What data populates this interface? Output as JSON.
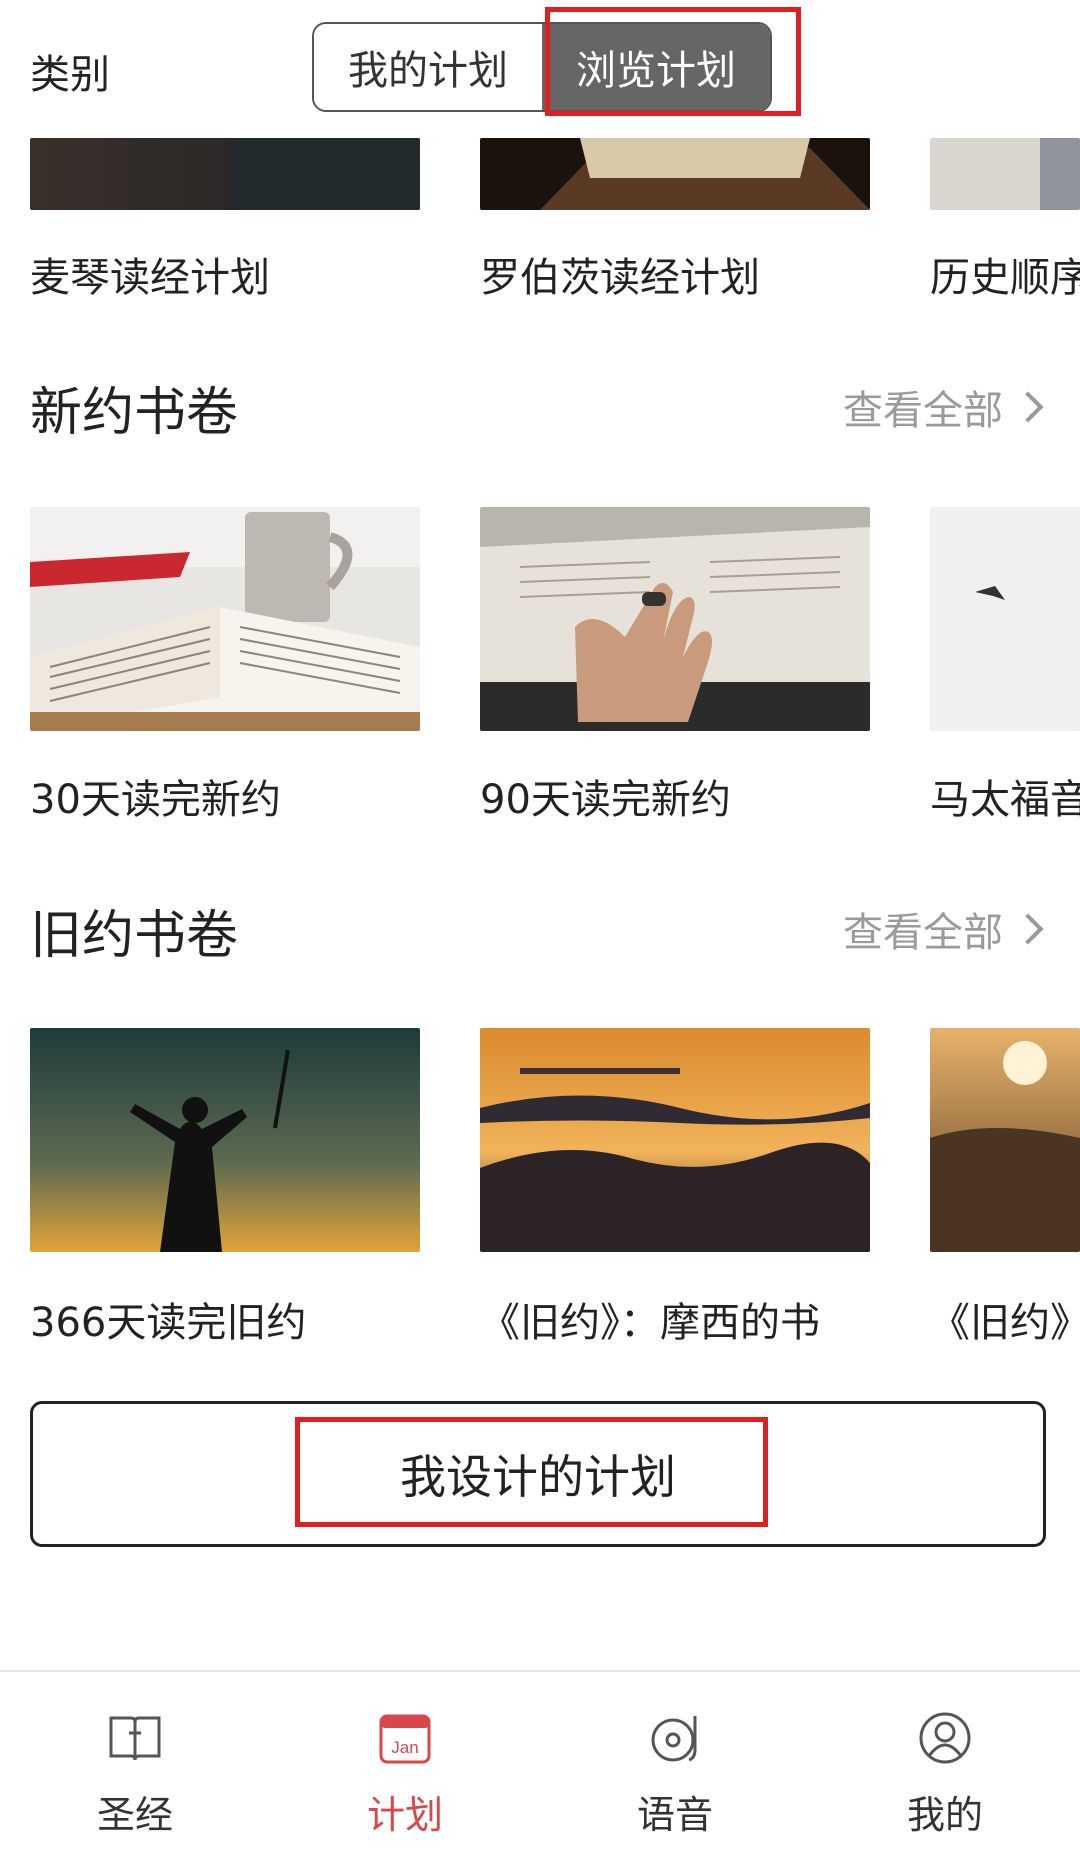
{
  "header": {
    "categories_label": "类别",
    "segments": [
      {
        "label": "我的计划",
        "active": false
      },
      {
        "label": "浏览计划",
        "active": true
      }
    ]
  },
  "top_row": {
    "items": [
      {
        "label": "麦琴读经计划"
      },
      {
        "label": "罗伯茨读经计划"
      },
      {
        "label": "历史顺序"
      }
    ]
  },
  "new_testament": {
    "title": "新约书卷",
    "see_all": "查看全部",
    "items": [
      {
        "label": "30天读完新约"
      },
      {
        "label": "90天读完新约"
      },
      {
        "label": "马太福音"
      }
    ]
  },
  "old_testament": {
    "title": "旧约书卷",
    "see_all": "查看全部",
    "items": [
      {
        "label": "366天读完旧约"
      },
      {
        "label": "《旧约》：摩西的书"
      },
      {
        "label": "《旧约》"
      }
    ]
  },
  "design_button_label": "我设计的计划",
  "tabbar": {
    "tabs": [
      {
        "label": "圣经",
        "icon": "bible-icon",
        "active": false
      },
      {
        "label": "计划",
        "icon": "calendar-icon",
        "active": true,
        "icon_text": "Jan"
      },
      {
        "label": "语音",
        "icon": "audio-disc-icon",
        "active": false
      },
      {
        "label": "我的",
        "icon": "user-icon",
        "active": false
      }
    ]
  },
  "colors": {
    "accent": "#d9474b",
    "highlight_box": "#e02020",
    "segment_active_bg": "#666666"
  }
}
